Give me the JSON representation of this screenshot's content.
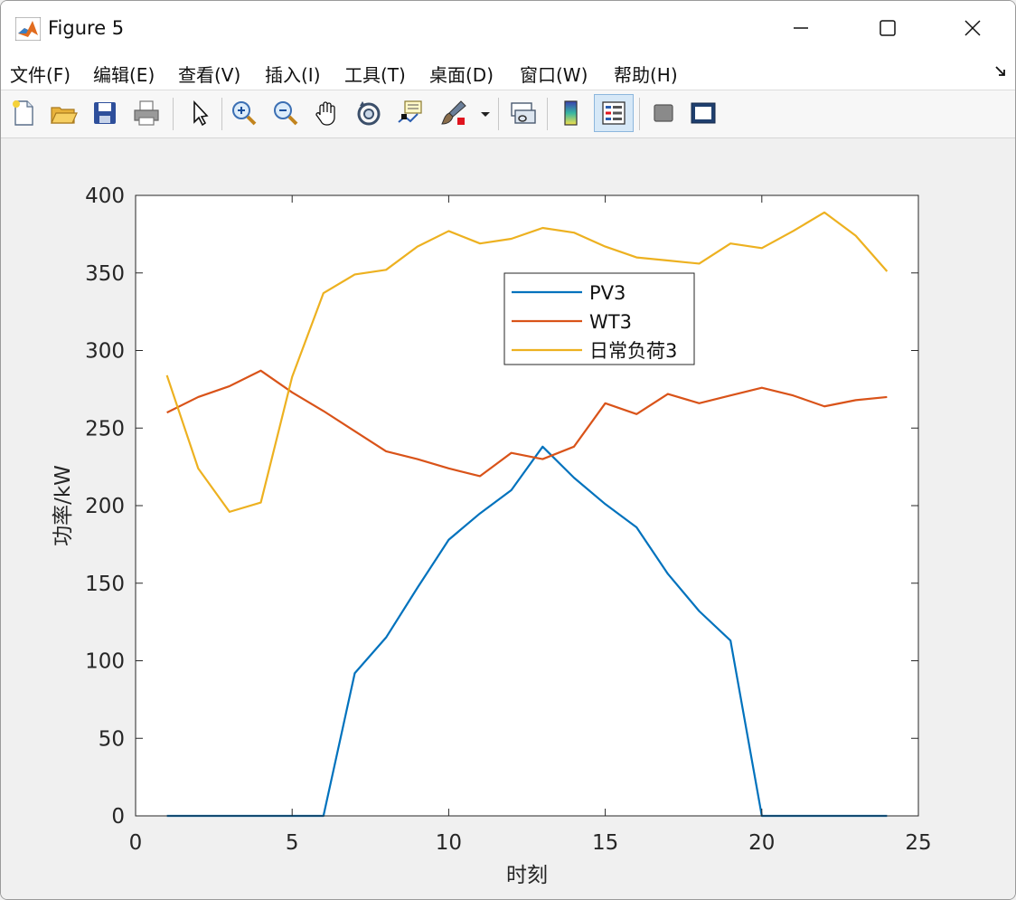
{
  "window": {
    "title": "Figure 5"
  },
  "menu": {
    "items": [
      {
        "label": "文件(F)",
        "name": "menu-file"
      },
      {
        "label": "编辑(E)",
        "name": "menu-edit"
      },
      {
        "label": "查看(V)",
        "name": "menu-view"
      },
      {
        "label": "插入(I)",
        "name": "menu-insert"
      },
      {
        "label": "工具(T)",
        "name": "menu-tools"
      },
      {
        "label": "桌面(D)",
        "name": "menu-desktop"
      },
      {
        "label": "窗口(W)",
        "name": "menu-window"
      },
      {
        "label": "帮助(H)",
        "name": "menu-help"
      }
    ]
  },
  "toolbar": {
    "buttons": [
      "new-figure-icon",
      "open-file-icon",
      "save-icon",
      "print-icon",
      "select-arrow-icon",
      "zoom-in-icon",
      "zoom-out-icon",
      "pan-hand-icon",
      "rotate-3d-icon",
      "data-cursor-icon",
      "brush-icon",
      "link-plot-icon",
      "colorbar-icon",
      "legend-icon",
      "hide-plot-tools-icon",
      "show-plot-tools-icon"
    ],
    "active": "legend-icon"
  },
  "chart_data": {
    "type": "line",
    "title": "",
    "xlabel": "时刻",
    "ylabel": "功率/kW",
    "xlim": [
      0,
      25
    ],
    "ylim": [
      0,
      400
    ],
    "xticks": [
      0,
      5,
      10,
      15,
      20,
      25
    ],
    "yticks": [
      0,
      50,
      100,
      150,
      200,
      250,
      300,
      350,
      400
    ],
    "grid": false,
    "legend_position": "upper-center",
    "x": [
      1,
      2,
      3,
      4,
      5,
      6,
      7,
      8,
      9,
      10,
      11,
      12,
      13,
      14,
      15,
      16,
      17,
      18,
      19,
      20,
      21,
      22,
      23,
      24
    ],
    "series": [
      {
        "name": "PV3",
        "color": "#0072bd",
        "values": [
          0,
          0,
          0,
          0,
          0,
          0,
          92,
          115,
          147,
          178,
          195,
          210,
          238,
          218,
          201,
          186,
          156,
          132,
          113,
          0,
          0,
          0,
          0,
          0
        ]
      },
      {
        "name": "WT3",
        "color": "#d95319",
        "values": [
          260,
          270,
          277,
          287,
          273,
          261,
          248,
          235,
          230,
          224,
          219,
          234,
          230,
          238,
          266,
          259,
          272,
          266,
          271,
          276,
          271,
          264,
          268,
          270
        ]
      },
      {
        "name": "日常负荷3",
        "color": "#edb120",
        "values": [
          284,
          224,
          196,
          202,
          283,
          337,
          349,
          352,
          367,
          377,
          369,
          372,
          379,
          376,
          367,
          360,
          358,
          356,
          369,
          366,
          377,
          389,
          374,
          351
        ]
      }
    ]
  }
}
